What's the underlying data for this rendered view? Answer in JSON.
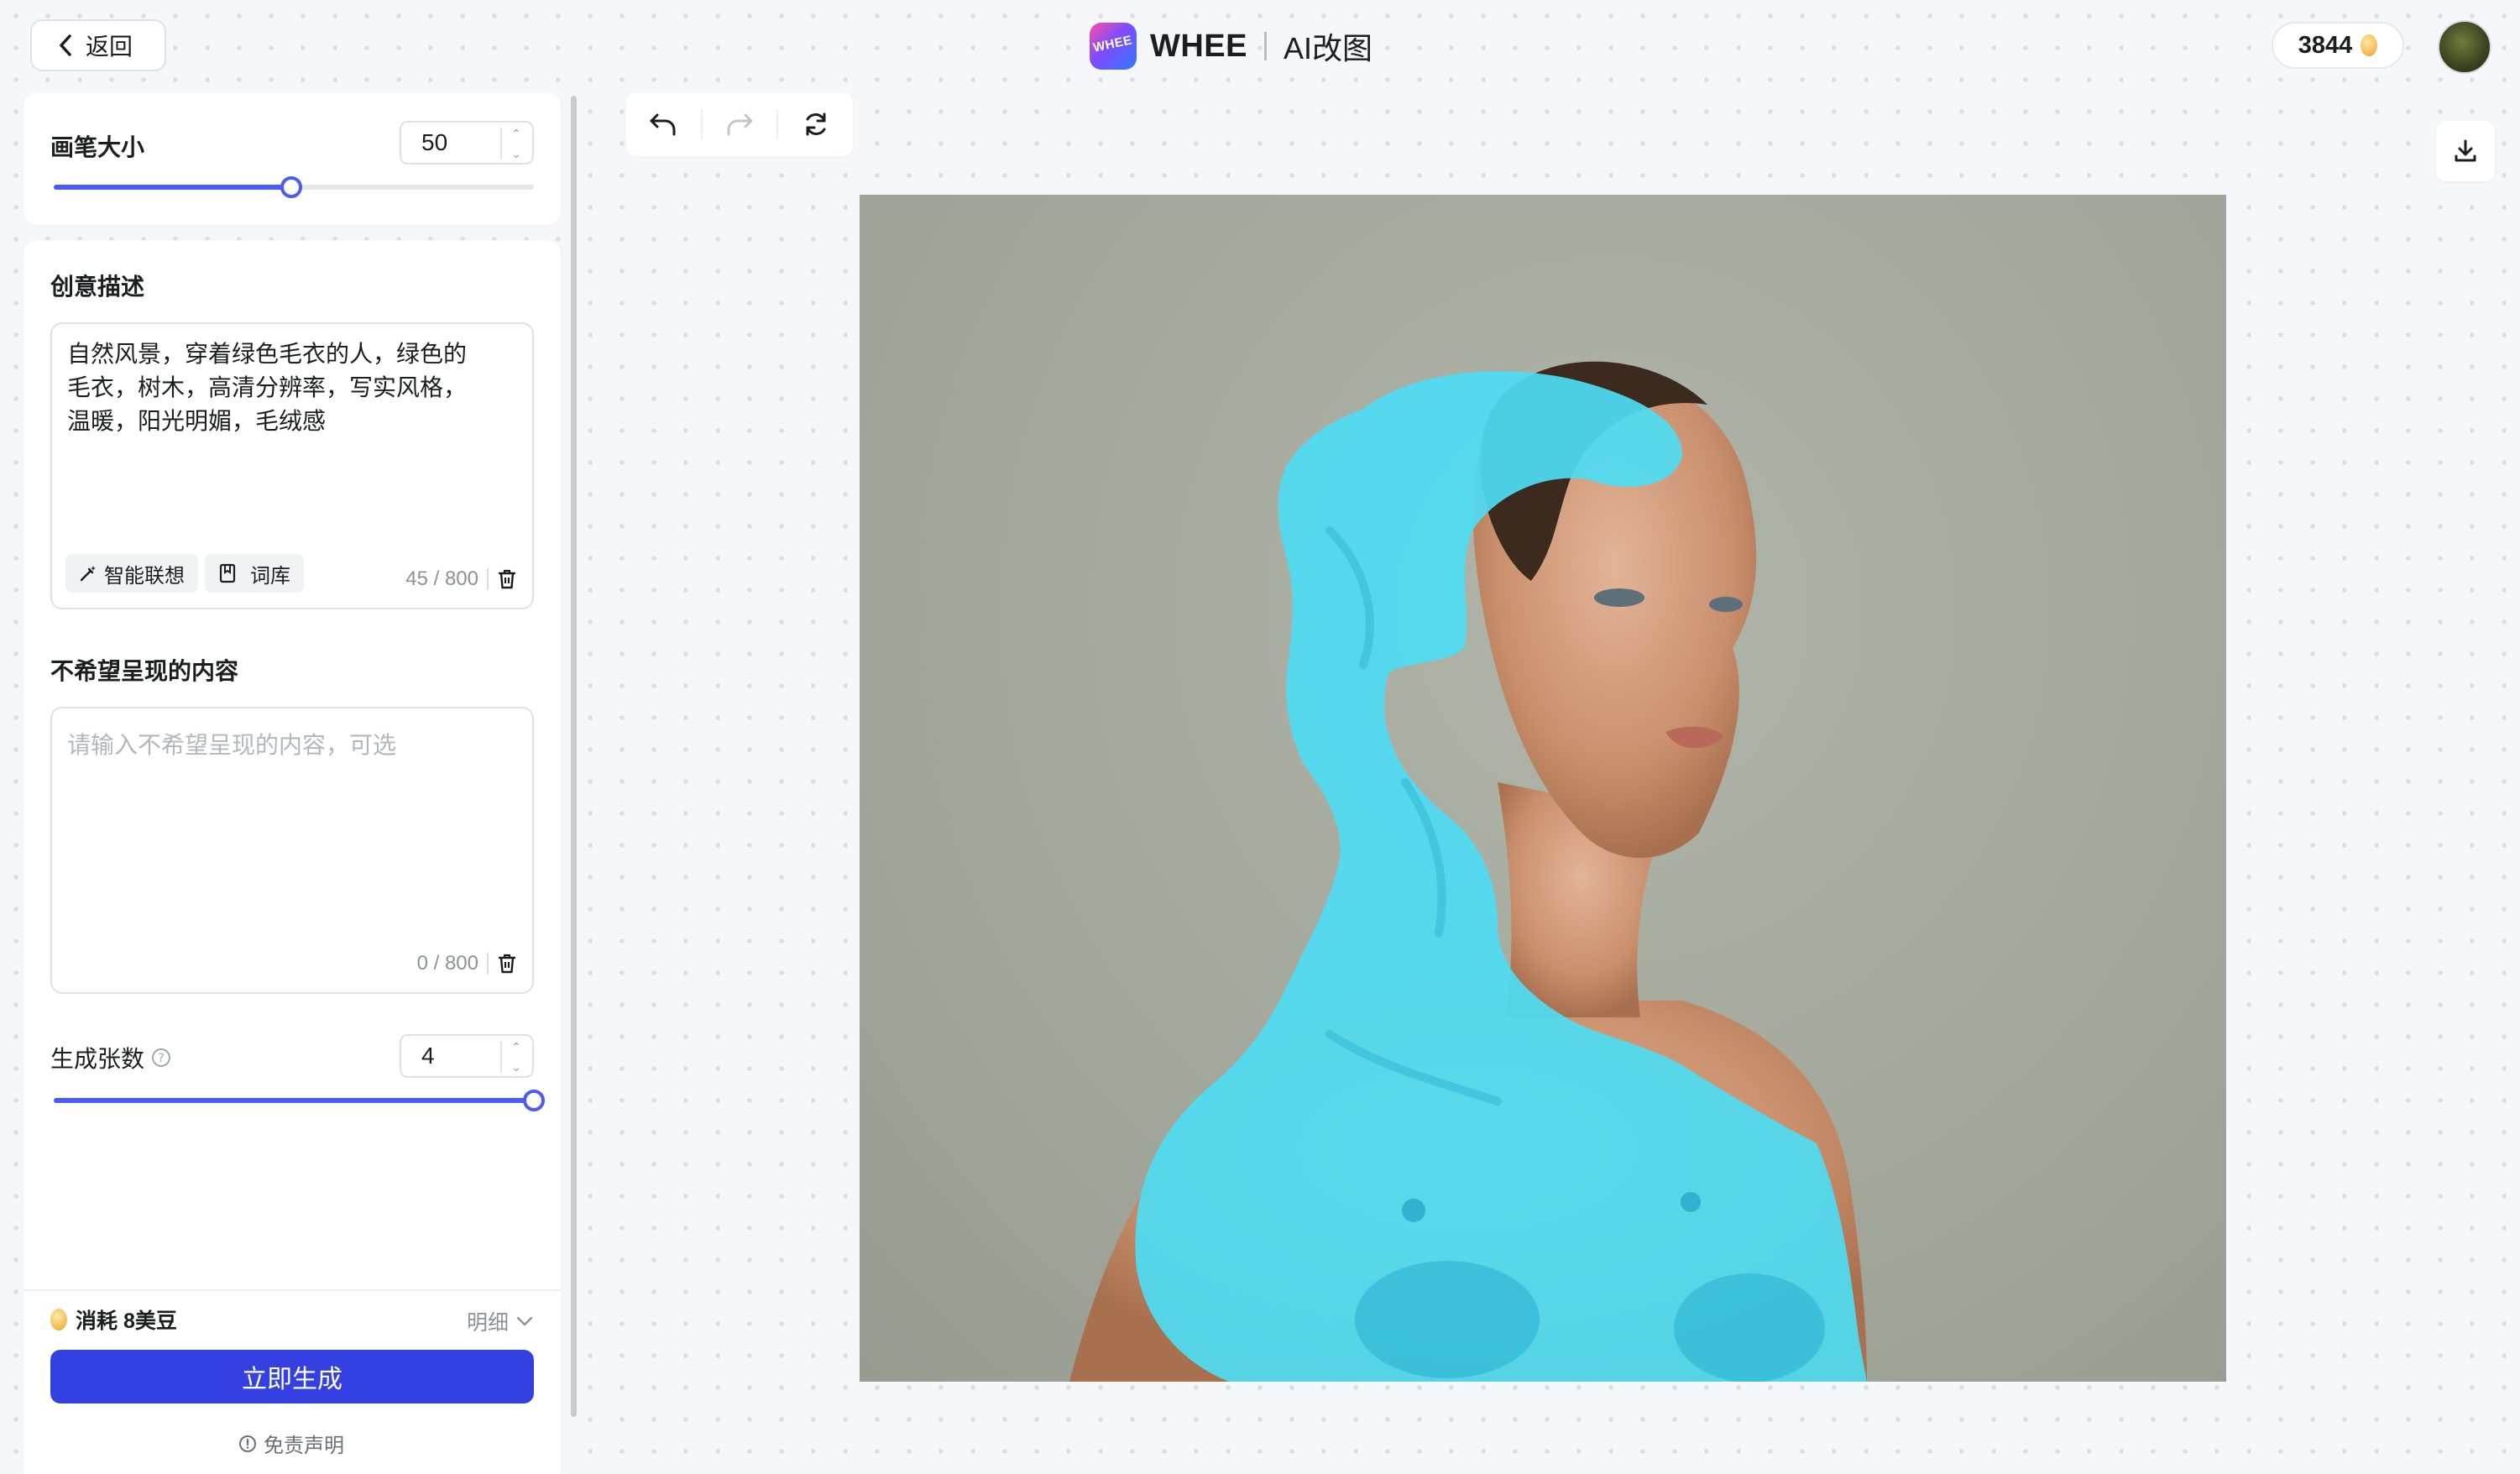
{
  "header": {
    "back_label": "返回",
    "brand": "WHEE",
    "logo_mark_text": "WHEE",
    "page_title": "AI改图",
    "beans_count": "3844"
  },
  "brush": {
    "label": "画笔大小",
    "value": "50",
    "level": 0.5
  },
  "prompt": {
    "label": "创意描述",
    "text": "自然风景，穿着绿色毛衣的人，绿色的\n毛衣，树木，高清分辨率，写实风格，\n温暖，阳光明媚，毛绒感",
    "smart_label": "智能联想",
    "library_label": "词库",
    "counter": "45 / 800"
  },
  "negative": {
    "label": "不希望呈现的内容",
    "placeholder": "请输入不希望呈现的内容，可选",
    "counter": "0 / 800"
  },
  "count": {
    "label": "生成张数",
    "value": "4",
    "level": 1.0
  },
  "footer": {
    "cost_label": "消耗 8美豆",
    "detail_label": "明细",
    "generate_label": "立即生成",
    "disclaimer_label": "免责声明"
  },
  "toolbar": {
    "undo": "undo-icon",
    "redo": "redo-icon",
    "reset": "refresh-icon"
  },
  "colors": {
    "accent": "#3540e3",
    "slider": "#4c5bf0",
    "mask": "#4fdcf2"
  }
}
